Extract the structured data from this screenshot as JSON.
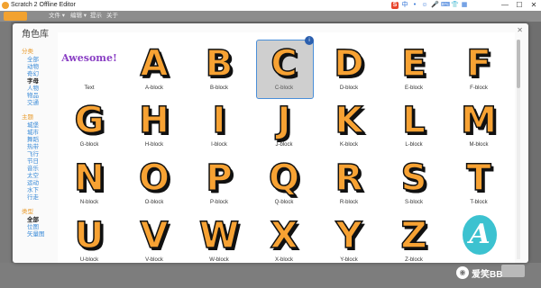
{
  "window": {
    "title": "Scratch 2 Offline Editor",
    "controls": [
      "—",
      "☐",
      "✕"
    ],
    "ime_glyphs": [
      "S",
      "中",
      "•",
      "☺",
      "🎤",
      "⌨",
      "👕",
      "▦"
    ]
  },
  "menubar": {
    "items": [
      "文件 ▾",
      "编辑 ▾",
      "提示",
      "关于"
    ]
  },
  "dialog": {
    "title": "角色库",
    "categories": {
      "heading_category": "分类",
      "category_items": [
        "全部",
        "动物",
        "奇幻",
        "字母",
        "人物",
        "物品",
        "交通"
      ],
      "category_selected": "字母",
      "heading_theme": "主题",
      "theme_items": [
        "城堡",
        "城市",
        "舞蹈",
        "热带",
        "飞行",
        "节日",
        "音乐",
        "太空",
        "运动",
        "水下",
        "行走"
      ],
      "heading_type": "类型",
      "type_items": [
        "全部",
        "位图",
        "矢量图"
      ],
      "type_selected": "全部"
    },
    "sprites": [
      {
        "glyph": "",
        "label": "Text",
        "special": "awesome",
        "special_text": "Awesome!"
      },
      {
        "glyph": "A",
        "label": "A-block"
      },
      {
        "glyph": "B",
        "label": "B-block"
      },
      {
        "glyph": "C",
        "label": "C-block",
        "selected": true,
        "badge": "i"
      },
      {
        "glyph": "D",
        "label": "D-block"
      },
      {
        "glyph": "E",
        "label": "E-block"
      },
      {
        "glyph": "F",
        "label": "F-block"
      },
      {
        "glyph": "G",
        "label": "G-block"
      },
      {
        "glyph": "H",
        "label": "H-block"
      },
      {
        "glyph": "I",
        "label": "I-block"
      },
      {
        "glyph": "J",
        "label": "J-block"
      },
      {
        "glyph": "K",
        "label": "K-block"
      },
      {
        "glyph": "L",
        "label": "L-block"
      },
      {
        "glyph": "M",
        "label": "M-block"
      },
      {
        "glyph": "N",
        "label": "N-block"
      },
      {
        "glyph": "O",
        "label": "O-block"
      },
      {
        "glyph": "P",
        "label": "P-block"
      },
      {
        "glyph": "Q",
        "label": "Q-block"
      },
      {
        "glyph": "R",
        "label": "R-block"
      },
      {
        "glyph": "S",
        "label": "S-block"
      },
      {
        "glyph": "T",
        "label": "T-block"
      },
      {
        "glyph": "U",
        "label": "U-block"
      },
      {
        "glyph": "V",
        "label": "V-block"
      },
      {
        "glyph": "W",
        "label": "W-block"
      },
      {
        "glyph": "X",
        "label": "X-block"
      },
      {
        "glyph": "Y",
        "label": "Y-block"
      },
      {
        "glyph": "Z",
        "label": "Z-block"
      },
      {
        "glyph": "",
        "label": "",
        "special": "cursive",
        "special_text": "A"
      }
    ]
  },
  "watermark": {
    "text": "爱笑BB"
  },
  "colors": {
    "letter_fill": "#f7a233",
    "letter_outline": "#111111",
    "category_heading": "#e89a2b",
    "category_link": "#3a8bd8",
    "selection_border": "#4a8fd9"
  }
}
